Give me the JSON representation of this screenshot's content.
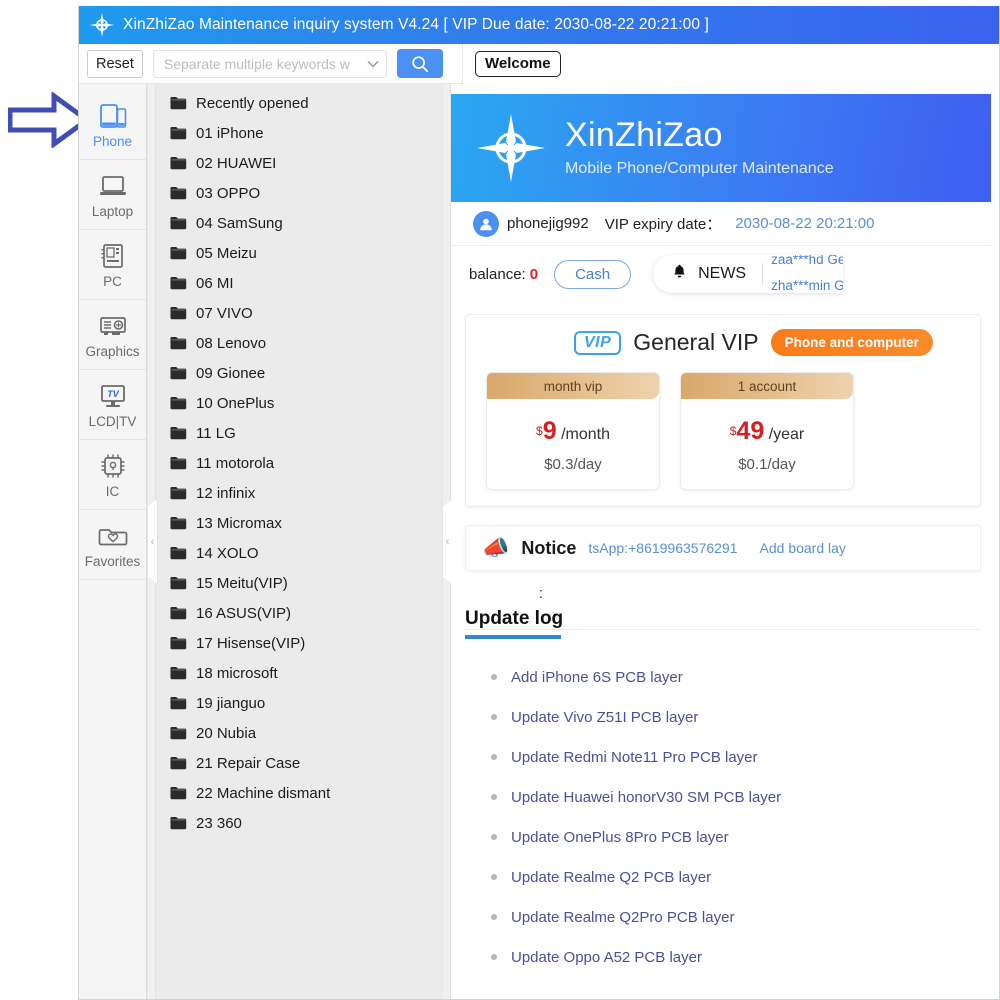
{
  "window": {
    "title": "XinZhiZao Maintenance inquiry system V4.24 [ VIP Due date: 2030-08-22 20:21:00 ]",
    "logo_icon": "compass-star-icon"
  },
  "toolbar": {
    "reset_label": "Reset",
    "search_placeholder": "Separate multiple keywords w",
    "search_value": "",
    "dropdown_icon": "chevron-down-icon",
    "search_icon": "search-icon"
  },
  "tabs": [
    {
      "label": "Welcome",
      "active": true
    }
  ],
  "rail": {
    "items": [
      {
        "label": "Phone",
        "icon": "phone-tablet-icon",
        "active": true
      },
      {
        "label": "Laptop",
        "icon": "laptop-icon",
        "active": false
      },
      {
        "label": "PC",
        "icon": "motherboard-icon",
        "active": false
      },
      {
        "label": "Graphics",
        "icon": "graphics-card-icon",
        "active": false
      },
      {
        "label": "LCD|TV",
        "icon": "tv-monitor-icon",
        "active": false
      },
      {
        "label": "IC",
        "icon": "chip-icon",
        "active": false
      },
      {
        "label": "Favorites",
        "icon": "folder-heart-icon",
        "active": false
      }
    ]
  },
  "folders": {
    "items": [
      "Recently opened",
      "01 iPhone",
      "02 HUAWEI",
      "03 OPPO",
      "04 SamSung",
      "05 Meizu",
      "06 MI",
      "07 VIVO",
      "08 Lenovo",
      "09 Gionee",
      "10 OnePlus",
      "11 LG",
      "11 motorola",
      "12 infinix",
      "13 Micromax",
      "14 XOLO",
      "15 Meitu(VIP)",
      "16 ASUS(VIP)",
      "17 Hisense(VIP)",
      "18 microsoft",
      "19 jianguo",
      "20 Nubia",
      "21 Repair Case",
      "22 Machine dismant",
      "23 360"
    ]
  },
  "splitter": {
    "collapse_icon": "chevron-left-icon"
  },
  "banner": {
    "brand": "XinZhiZao",
    "tagline": "Mobile Phone/Computer Maintenance",
    "logo_icon": "compass-star-icon"
  },
  "user": {
    "avatar_icon": "user-avatar-icon",
    "name": "phonejig992",
    "expiry_label": "VIP expiry date：",
    "expiry_date": "2030-08-22 20:21:00"
  },
  "balance": {
    "label": "balance:",
    "value": "0",
    "cash_label": "Cash",
    "news_label": "NEWS",
    "news_icon": "bell-icon",
    "news_ticker_1": "zaa***hd  Get",
    "news_ticker_2": "zha***min  Get"
  },
  "vip": {
    "badge": "VIP",
    "badge_icon": "vip-badge-icon",
    "title": "General VIP",
    "pill_label": "Phone and computer",
    "plans": [
      {
        "header": "month vip",
        "currency": "$",
        "amount": "9",
        "period": "/month",
        "sub": "$0.3/day"
      },
      {
        "header": "1 account",
        "currency": "$",
        "amount": "49",
        "period": "/year",
        "sub": "$0.1/day"
      }
    ]
  },
  "notice": {
    "icon": "megaphone-icon",
    "title": "Notice",
    "link1": "tsApp:+8619963576291",
    "link2": "Add board lay"
  },
  "update_log": {
    "colon": ":",
    "title": "Update log",
    "items": [
      "Add iPhone 6S PCB layer",
      "Update Vivo Z51I PCB layer",
      "Update Redmi Note11 Pro PCB layer",
      "Update Huawei honorV30 SM PCB layer",
      "Update OnePlus 8Pro PCB layer",
      "Update Realme Q2 PCB layer",
      "Update Realme Q2Pro PCB layer",
      "Update Oppo A52 PCB layer"
    ]
  },
  "annotation": {
    "arrow_icon": "right-arrow-annotation-icon"
  },
  "colors": {
    "titlebar_start": "#1e9bef",
    "titlebar_end": "#3a63f0",
    "accent_blue": "#4a90f5",
    "link_blue": "#5b8fd4",
    "price_red": "#d32020",
    "orange_pill": "#f97c1c",
    "arrow_purple": "#3f4db5"
  }
}
